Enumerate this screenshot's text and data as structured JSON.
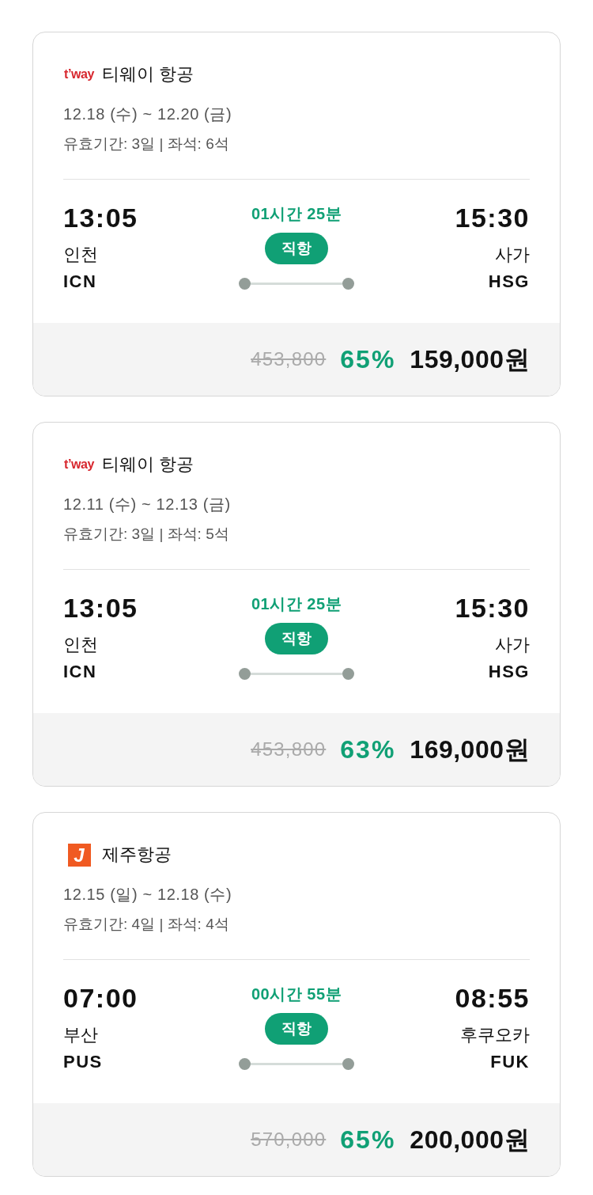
{
  "flights": [
    {
      "airline": {
        "logo": {
          "kind": "tway",
          "text": "t’way"
        },
        "name": "티웨이 항공"
      },
      "dates": "12.18 (수) ~ 12.20 (금)",
      "details": "유효기간: 3일 | 좌석: 6석",
      "departure": {
        "time": "13:05",
        "city": "인천",
        "code": "ICN"
      },
      "duration": "01시간 25분",
      "route_type": "직항",
      "arrival": {
        "time": "15:30",
        "city": "사가",
        "code": "HSG"
      },
      "original_price": "453,800",
      "discount": "65%",
      "price": "159,000원"
    },
    {
      "airline": {
        "logo": {
          "kind": "tway",
          "text": "t’way"
        },
        "name": "티웨이 항공"
      },
      "dates": "12.11 (수) ~ 12.13 (금)",
      "details": "유효기간: 3일 | 좌석: 5석",
      "departure": {
        "time": "13:05",
        "city": "인천",
        "code": "ICN"
      },
      "duration": "01시간 25분",
      "route_type": "직항",
      "arrival": {
        "time": "15:30",
        "city": "사가",
        "code": "HSG"
      },
      "original_price": "453,800",
      "discount": "63%",
      "price": "169,000원"
    },
    {
      "airline": {
        "logo": {
          "kind": "jeju",
          "text": "J"
        },
        "name": "제주항공"
      },
      "dates": "12.15 (일) ~ 12.18 (수)",
      "details": "유효기간: 4일 | 좌석: 4석",
      "departure": {
        "time": "07:00",
        "city": "부산",
        "code": "PUS"
      },
      "duration": "00시간 55분",
      "route_type": "직항",
      "arrival": {
        "time": "08:55",
        "city": "후쿠오카",
        "code": "FUK"
      },
      "original_price": "570,000",
      "discount": "65%",
      "price": "200,000원"
    }
  ]
}
